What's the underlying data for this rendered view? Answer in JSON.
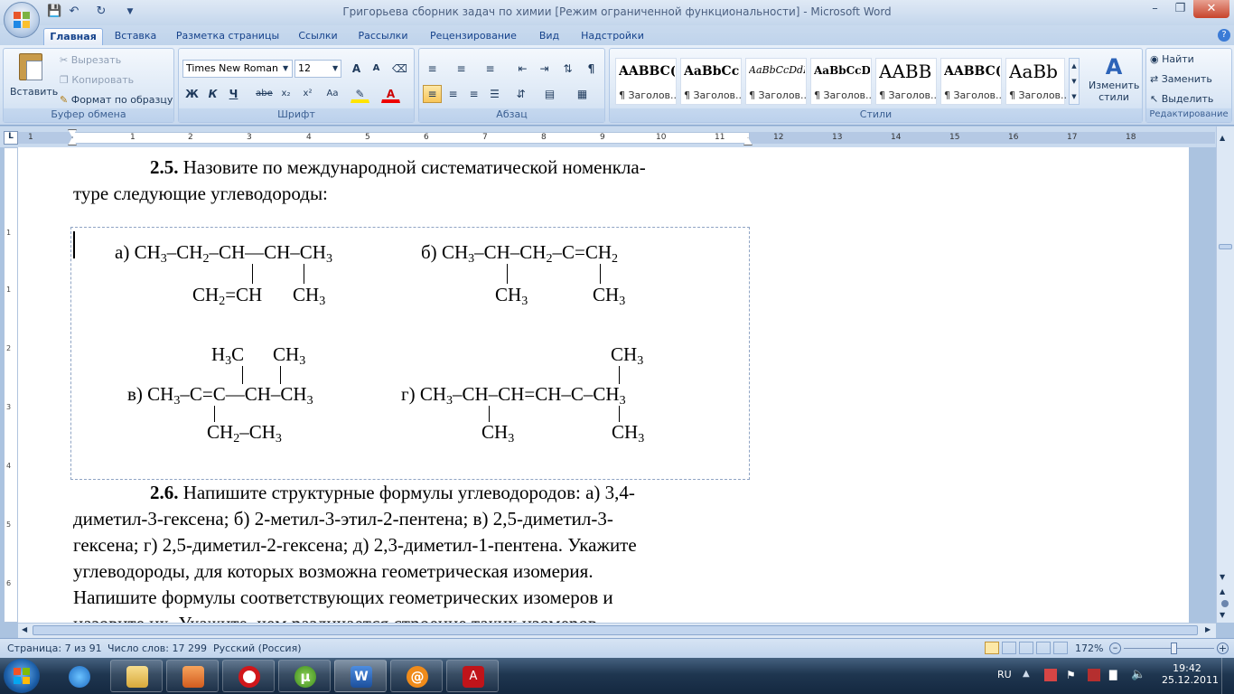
{
  "window": {
    "title": "Григорьева сборник задач по химии [Режим ограниченной функциональности] - Microsoft Word"
  },
  "quick_access": {
    "save_icon": "save-icon",
    "undo_icon": "undo-icon",
    "redo_icon": "redo-icon",
    "customize_icon": "customize-icon"
  },
  "tabs": [
    "Главная",
    "Вставка",
    "Разметка страницы",
    "Ссылки",
    "Рассылки",
    "Рецензирование",
    "Вид",
    "Надстройки"
  ],
  "clipboard": {
    "paste": "Вставить",
    "cut": "Вырезать",
    "copy": "Копировать",
    "format_painter": "Формат по образцу",
    "label": "Буфер обмена"
  },
  "font": {
    "name": "Times New Roman",
    "size": "12",
    "label": "Шрифт",
    "bold": "Ж",
    "italic": "К",
    "underline": "Ч",
    "strike": "abe",
    "subscript": "x₂",
    "superscript": "x²",
    "case": "Aa",
    "grow": "A",
    "shrink": "A"
  },
  "paragraph": {
    "label": "Абзац"
  },
  "styles": {
    "label": "Стили",
    "change": [
      "Изменить",
      "стили"
    ],
    "tiles": [
      {
        "sample": "AABBC(",
        "name": "¶ Заголов...",
        "size": 14,
        "bold": true
      },
      {
        "sample": "AaBbCcI",
        "name": "¶ Заголов...",
        "size": 14,
        "bold": true
      },
      {
        "sample": "AaBbCcDdE",
        "name": "¶ Заголов...",
        "size": 11,
        "italic": true
      },
      {
        "sample": "AaBbCcDdI",
        "name": "¶ Заголов...",
        "size": 12,
        "bold": true
      },
      {
        "sample": "AABB",
        "name": "¶ Заголов...",
        "size": 20
      },
      {
        "sample": "AABBC(",
        "name": "¶ Заголов...",
        "size": 14,
        "bold": true
      },
      {
        "sample": "AaBb",
        "name": "¶ Заголов...",
        "size": 20
      }
    ]
  },
  "editing": {
    "find": "Найти",
    "replace": "Заменить",
    "select": "Выделить",
    "label": "Редактирование"
  },
  "ruler": {
    "numbers": [
      "1",
      "1",
      "2",
      "3",
      "4",
      "5",
      "6",
      "7",
      "8",
      "9",
      "10",
      "11",
      "12",
      "13",
      "14",
      "15",
      "16",
      "17",
      "18"
    ],
    "vnumbers": [
      "1",
      "1",
      "2",
      "3",
      "4",
      "5",
      "6"
    ]
  },
  "document": {
    "p25": {
      "num": "2.5.",
      "line1": " Назовите по международной систематической номенкла-",
      "line2": "туре следующие углеводороды:"
    },
    "a": {
      "label": "а)",
      "main": [
        [
          "CH",
          "3"
        ],
        [
          "–CH",
          "2"
        ],
        [
          "–CH—CH–CH",
          "3"
        ]
      ],
      "sub1": [
        [
          "CH",
          "2"
        ],
        [
          "=CH",
          ""
        ]
      ],
      "sub2": [
        [
          "CH",
          "3"
        ]
      ]
    },
    "b": {
      "label": "б)",
      "main": [
        [
          "CH",
          "3"
        ],
        [
          "–CH–CH",
          "2"
        ],
        [
          "–C=CH",
          "2"
        ]
      ],
      "sub1": [
        [
          "CH",
          "3"
        ]
      ],
      "sub2": [
        [
          "CH",
          "3"
        ]
      ]
    },
    "v": {
      "label": "в)",
      "top1": [
        [
          "H",
          "3"
        ],
        [
          "C",
          ""
        ]
      ],
      "top2": [
        [
          "CH",
          "3"
        ]
      ],
      "main": [
        [
          "CH",
          "3"
        ],
        [
          "–C=C—CH–CH",
          "3"
        ]
      ],
      "bottom": [
        [
          "CH",
          "2"
        ],
        [
          "–CH",
          "3"
        ]
      ]
    },
    "g": {
      "label": "г)",
      "top": [
        [
          "CH",
          "3"
        ]
      ],
      "main": [
        [
          "CH",
          "3"
        ],
        [
          "–CH–CH=CH–C–CH",
          "3"
        ]
      ],
      "bottom1": [
        [
          "CH",
          "3"
        ]
      ],
      "bottom2": [
        [
          "CH",
          "3"
        ]
      ]
    },
    "p26": {
      "num": "2.6.",
      "line1": " Напишите структурные формулы углеводородов: а) 3,4-",
      "line2": "диметил-3-гексена;   б) 2-метил-3-этил-2-пентена;   в) 2,5-диметил-3-",
      "line3": "гексена; г) 2,5-диметил-2-гексена; д) 2,3-диметил-1-пентена. Укажите",
      "line4": "углеводороды,  для  которых  возможна  геометрическая  изомерия.",
      "line5": "Напишите  формулы  соответствующих  геометрических  изомеров  и",
      "line6": "назовите  их.  Укажите,  чем  различается  строение  таких  изомеров."
    }
  },
  "status": {
    "page": "Страница: 7 из 91",
    "words": "Число слов: 17 299",
    "lang": "Русский (Россия)",
    "zoom": "172%"
  },
  "tray": {
    "lang": "RU",
    "time": "19:42",
    "date": "25.12.2011"
  }
}
